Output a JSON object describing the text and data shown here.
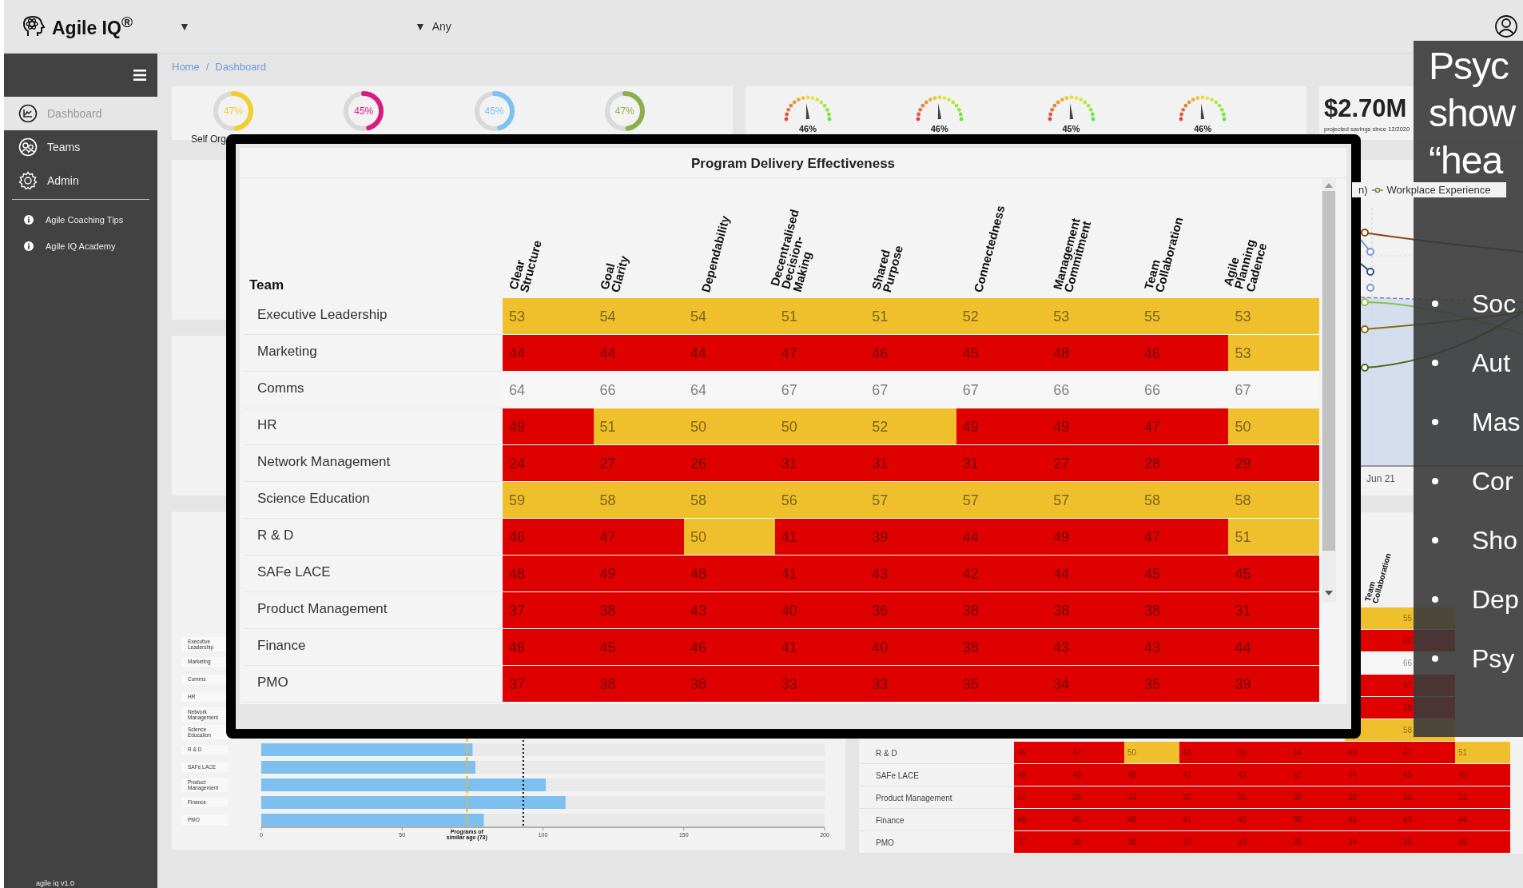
{
  "header": {
    "logo": "Agile IQ$^{®}$",
    "filters": [
      {
        "caret": "▼"
      },
      {
        "caret": "▼",
        "value": "Any"
      }
    ]
  },
  "sidebar": {
    "items": [
      {
        "label": "Dashboard",
        "kind": "chart",
        "selected": true
      },
      {
        "label": "Teams",
        "kind": "people",
        "selected": false
      },
      {
        "label": "Admin",
        "kind": "gear",
        "selected": false
      }
    ],
    "links": [
      {
        "label": "Agile Coaching Tips"
      },
      {
        "label": "Agile IQ Academy"
      }
    ],
    "version": "agile iq v1.0"
  },
  "breadcrumb": [
    "Home",
    "/",
    "Dashboard"
  ],
  "donuts": [
    {
      "value": "47%",
      "level": 0.47,
      "color": "#f0cf2e",
      "label": "Self Org"
    },
    {
      "value": "45%",
      "level": 0.45,
      "color": "#d81b85"
    },
    {
      "value": "45%",
      "level": 0.45,
      "color": "#7dc1ee"
    },
    {
      "value": "47%",
      "level": 0.47,
      "color": "#8bb04a"
    }
  ],
  "gauges": [
    {
      "value": "46%"
    },
    {
      "value": "46%"
    },
    {
      "value": "45%"
    },
    {
      "value": "46%"
    }
  ],
  "savings": {
    "amount": "$2.70M",
    "caption": "projected savings since 12/2020"
  },
  "trend_chart": {
    "legend_fragment": "n)",
    "legend": "Workplace Experience",
    "x_label": "Jun 21"
  },
  "bar_card": {
    "chart_data": {
      "type": "bar",
      "orientation": "horizontal",
      "categories": [
        "Executive Leadership",
        "Marketing",
        "Comms",
        "HR",
        "Network Management",
        "Science Education",
        "R & D",
        "SAFe LACE",
        "Product Management",
        "Finance",
        "PMO"
      ],
      "values": [
        null,
        null,
        null,
        null,
        null,
        null,
        75,
        76,
        101,
        108,
        79
      ],
      "xlim": [
        0,
        200
      ],
      "xticks": [
        0,
        50,
        100,
        150,
        200
      ],
      "ref_lines": [
        {
          "axis": "x",
          "value": 73,
          "label": "Programs of similar age (73)"
        },
        {
          "axis": "x",
          "value": 93
        }
      ]
    }
  },
  "bg_table": {
    "columns": [
      "Team Collaboration"
    ],
    "rows": [
      {
        "cells": [
          {
            "color": "#f0c02c"
          },
          {
            "value": "55",
            "color": "#f0c02c"
          }
        ]
      },
      {
        "cells": [
          {
            "color": "#df0000"
          },
          {
            "value": "46",
            "color": "#df0000"
          }
        ]
      },
      {
        "cells": [
          {
            "color": "#f6f6f6"
          },
          {
            "value": "66",
            "color": "#f6f6f6"
          }
        ]
      },
      {
        "cells": [
          {
            "color": "#df0000"
          },
          {
            "value": "47",
            "color": "#df0000"
          }
        ]
      },
      {
        "cells": [
          {
            "color": "#df0000"
          },
          {
            "value": "28",
            "color": "#df0000"
          }
        ]
      },
      {
        "cells": [
          {
            "color": "#f0c02c"
          },
          {
            "value": "58",
            "color": "#f0c02c"
          }
        ]
      },
      {
        "team": "R & D",
        "cells": [
          {
            "value": "46",
            "color": "#df0000"
          },
          {
            "value": "47",
            "color": "#df0000"
          },
          {
            "value": "50",
            "color": "#f0c02c"
          },
          {
            "value": "41",
            "color": "#df0000"
          },
          {
            "value": "39",
            "color": "#df0000"
          },
          {
            "value": "44",
            "color": "#df0000"
          },
          {
            "value": "49",
            "color": "#df0000"
          },
          {
            "value": "47",
            "color": "#df0000"
          },
          {
            "value": "51",
            "color": "#f0c02c"
          }
        ]
      },
      {
        "team": "SAFe LACE",
        "cells": [
          {
            "value": "48",
            "color": "#df0000"
          },
          {
            "value": "49",
            "color": "#df0000"
          },
          {
            "value": "48",
            "color": "#df0000"
          },
          {
            "value": "41",
            "color": "#df0000"
          },
          {
            "value": "43",
            "color": "#df0000"
          },
          {
            "value": "42",
            "color": "#df0000"
          },
          {
            "value": "44",
            "color": "#df0000"
          },
          {
            "value": "45",
            "color": "#df0000"
          },
          {
            "value": "45",
            "color": "#df0000"
          }
        ]
      },
      {
        "team": "Product Management",
        "cells": [
          {
            "value": "37",
            "color": "#df0000"
          },
          {
            "value": "38",
            "color": "#df0000"
          },
          {
            "value": "43",
            "color": "#df0000"
          },
          {
            "value": "40",
            "color": "#df0000"
          },
          {
            "value": "36",
            "color": "#df0000"
          },
          {
            "value": "38",
            "color": "#df0000"
          },
          {
            "value": "38",
            "color": "#df0000"
          },
          {
            "value": "38",
            "color": "#df0000"
          },
          {
            "value": "31",
            "color": "#df0000"
          }
        ]
      },
      {
        "team": "Finance",
        "cells": [
          {
            "value": "46",
            "color": "#df0000"
          },
          {
            "value": "45",
            "color": "#df0000"
          },
          {
            "value": "46",
            "color": "#df0000"
          },
          {
            "value": "41",
            "color": "#df0000"
          },
          {
            "value": "40",
            "color": "#df0000"
          },
          {
            "value": "38",
            "color": "#df0000"
          },
          {
            "value": "43",
            "color": "#df0000"
          },
          {
            "value": "43",
            "color": "#df0000"
          },
          {
            "value": "44",
            "color": "#df0000"
          }
        ]
      },
      {
        "team": "PMO",
        "cells": [
          {
            "value": "37",
            "color": "#df0000"
          },
          {
            "value": "38",
            "color": "#df0000"
          },
          {
            "value": "38",
            "color": "#df0000"
          },
          {
            "value": "33",
            "color": "#df0000"
          },
          {
            "value": "33",
            "color": "#df0000"
          },
          {
            "value": "35",
            "color": "#df0000"
          },
          {
            "value": "34",
            "color": "#df0000"
          },
          {
            "value": "35",
            "color": "#df0000"
          },
          {
            "value": "39",
            "color": "#df0000"
          }
        ]
      }
    ]
  },
  "modal": {
    "title": "Program Delivery Effectiveness",
    "team_heading": "Team",
    "columns": [
      "Clear Structure",
      "Goal Clarity",
      "Dependability",
      "Decentralised Decision-Making",
      "Shared Purpose",
      "Connectedness",
      "Management Commitment",
      "Team Collaboration",
      "Agile Planning Cadence"
    ],
    "rows": [
      {
        "team": "Executive Leadership",
        "cells": [
          {
            "value": "53",
            "color": "#f0c02c"
          },
          {
            "value": "54",
            "color": "#f0c02c"
          },
          {
            "value": "54",
            "color": "#f0c02c"
          },
          {
            "value": "51",
            "color": "#f0c02c"
          },
          {
            "value": "51",
            "color": "#f0c02c"
          },
          {
            "value": "52",
            "color": "#f0c02c"
          },
          {
            "value": "53",
            "color": "#f0c02c"
          },
          {
            "value": "55",
            "color": "#f0c02c"
          },
          {
            "value": "53",
            "color": "#f0c02c"
          }
        ]
      },
      {
        "team": "Marketing",
        "cells": [
          {
            "value": "44",
            "color": "#df0000"
          },
          {
            "value": "44",
            "color": "#df0000"
          },
          {
            "value": "44",
            "color": "#df0000"
          },
          {
            "value": "47",
            "color": "#df0000"
          },
          {
            "value": "46",
            "color": "#df0000"
          },
          {
            "value": "45",
            "color": "#df0000"
          },
          {
            "value": "48",
            "color": "#df0000"
          },
          {
            "value": "46",
            "color": "#df0000"
          },
          {
            "value": "53",
            "color": "#f0c02c"
          }
        ]
      },
      {
        "team": "Comms",
        "cells": [
          {
            "value": "64",
            "color": "#f6f6f6"
          },
          {
            "value": "66",
            "color": "#f6f6f6"
          },
          {
            "value": "64",
            "color": "#f6f6f6"
          },
          {
            "value": "67",
            "color": "#f6f6f6"
          },
          {
            "value": "67",
            "color": "#f6f6f6"
          },
          {
            "value": "67",
            "color": "#f6f6f6"
          },
          {
            "value": "66",
            "color": "#f6f6f6"
          },
          {
            "value": "66",
            "color": "#f6f6f6"
          },
          {
            "value": "67",
            "color": "#f6f6f6"
          }
        ]
      },
      {
        "team": "HR",
        "cells": [
          {
            "value": "49",
            "color": "#df0000"
          },
          {
            "value": "51",
            "color": "#f0c02c"
          },
          {
            "value": "50",
            "color": "#f0c02c"
          },
          {
            "value": "50",
            "color": "#f0c02c"
          },
          {
            "value": "52",
            "color": "#f0c02c"
          },
          {
            "value": "49",
            "color": "#df0000"
          },
          {
            "value": "49",
            "color": "#df0000"
          },
          {
            "value": "47",
            "color": "#df0000"
          },
          {
            "value": "50",
            "color": "#f0c02c"
          }
        ]
      },
      {
        "team": "Network Management",
        "cells": [
          {
            "value": "24",
            "color": "#df0000"
          },
          {
            "value": "27",
            "color": "#df0000"
          },
          {
            "value": "26",
            "color": "#df0000"
          },
          {
            "value": "31",
            "color": "#df0000"
          },
          {
            "value": "31",
            "color": "#df0000"
          },
          {
            "value": "31",
            "color": "#df0000"
          },
          {
            "value": "27",
            "color": "#df0000"
          },
          {
            "value": "28",
            "color": "#df0000"
          },
          {
            "value": "29",
            "color": "#df0000"
          }
        ]
      },
      {
        "team": "Science Education",
        "cells": [
          {
            "value": "59",
            "color": "#f0c02c"
          },
          {
            "value": "58",
            "color": "#f0c02c"
          },
          {
            "value": "58",
            "color": "#f0c02c"
          },
          {
            "value": "56",
            "color": "#f0c02c"
          },
          {
            "value": "57",
            "color": "#f0c02c"
          },
          {
            "value": "57",
            "color": "#f0c02c"
          },
          {
            "value": "57",
            "color": "#f0c02c"
          },
          {
            "value": "58",
            "color": "#f0c02c"
          },
          {
            "value": "58",
            "color": "#f0c02c"
          }
        ]
      },
      {
        "team": "R & D",
        "cells": [
          {
            "value": "46",
            "color": "#df0000"
          },
          {
            "value": "47",
            "color": "#df0000"
          },
          {
            "value": "50",
            "color": "#f0c02c"
          },
          {
            "value": "41",
            "color": "#df0000"
          },
          {
            "value": "39",
            "color": "#df0000"
          },
          {
            "value": "44",
            "color": "#df0000"
          },
          {
            "value": "49",
            "color": "#df0000"
          },
          {
            "value": "47",
            "color": "#df0000"
          },
          {
            "value": "51",
            "color": "#f0c02c"
          }
        ]
      },
      {
        "team": "SAFe LACE",
        "cells": [
          {
            "value": "48",
            "color": "#df0000"
          },
          {
            "value": "49",
            "color": "#df0000"
          },
          {
            "value": "48",
            "color": "#df0000"
          },
          {
            "value": "41",
            "color": "#df0000"
          },
          {
            "value": "43",
            "color": "#df0000"
          },
          {
            "value": "42",
            "color": "#df0000"
          },
          {
            "value": "44",
            "color": "#df0000"
          },
          {
            "value": "45",
            "color": "#df0000"
          },
          {
            "value": "45",
            "color": "#df0000"
          }
        ]
      },
      {
        "team": "Product Management",
        "cells": [
          {
            "value": "37",
            "color": "#df0000"
          },
          {
            "value": "38",
            "color": "#df0000"
          },
          {
            "value": "43",
            "color": "#df0000"
          },
          {
            "value": "40",
            "color": "#df0000"
          },
          {
            "value": "36",
            "color": "#df0000"
          },
          {
            "value": "38",
            "color": "#df0000"
          },
          {
            "value": "38",
            "color": "#df0000"
          },
          {
            "value": "38",
            "color": "#df0000"
          },
          {
            "value": "31",
            "color": "#df0000"
          }
        ]
      },
      {
        "team": "Finance",
        "cells": [
          {
            "value": "46",
            "color": "#df0000"
          },
          {
            "value": "45",
            "color": "#df0000"
          },
          {
            "value": "46",
            "color": "#df0000"
          },
          {
            "value": "41",
            "color": "#df0000"
          },
          {
            "value": "40",
            "color": "#df0000"
          },
          {
            "value": "38",
            "color": "#df0000"
          },
          {
            "value": "43",
            "color": "#df0000"
          },
          {
            "value": "43",
            "color": "#df0000"
          },
          {
            "value": "44",
            "color": "#df0000"
          }
        ]
      },
      {
        "team": "PMO",
        "cells": [
          {
            "value": "37",
            "color": "#df0000"
          },
          {
            "value": "38",
            "color": "#df0000"
          },
          {
            "value": "38",
            "color": "#df0000"
          },
          {
            "value": "33",
            "color": "#df0000"
          },
          {
            "value": "33",
            "color": "#df0000"
          },
          {
            "value": "35",
            "color": "#df0000"
          },
          {
            "value": "34",
            "color": "#df0000"
          },
          {
            "value": "35",
            "color": "#df0000"
          },
          {
            "value": "39",
            "color": "#df0000"
          }
        ]
      }
    ]
  },
  "slide": {
    "title_lines": [
      "Psyc",
      "show",
      "“hea"
    ],
    "bullets": [
      "Soc",
      "Aut",
      "Mas",
      "Cor",
      "Sho",
      "Dep",
      "Psy"
    ]
  }
}
